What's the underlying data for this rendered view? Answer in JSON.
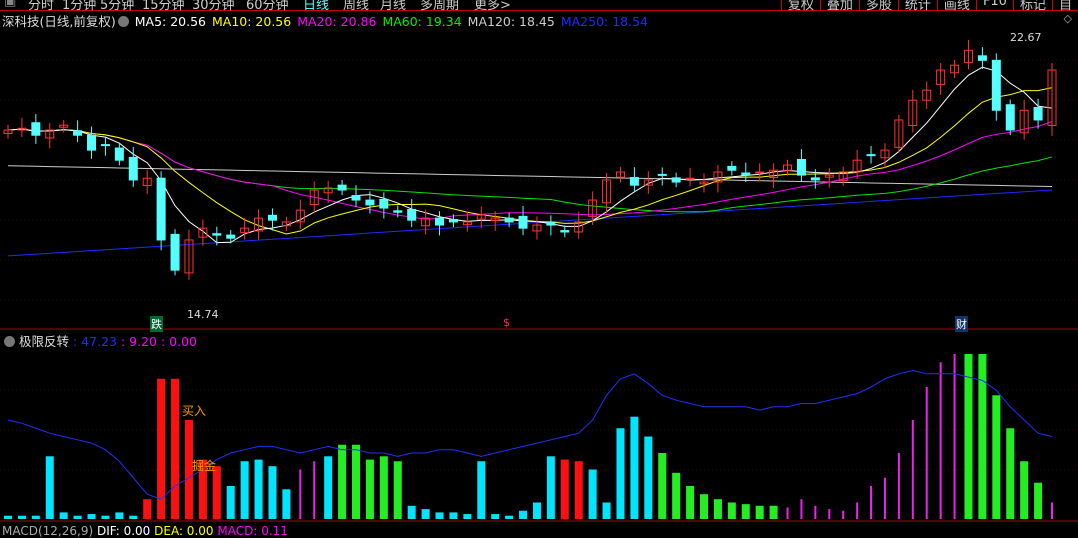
{
  "period_tabs": [
    "分时",
    "1分钟",
    "5分钟",
    "15分钟",
    "30分钟",
    "60分钟",
    "日线",
    "周线",
    "月线",
    "多周期",
    "更多>"
  ],
  "active_tab": "日线",
  "right_tabs": [
    "复权",
    "叠加",
    "多股",
    "统计",
    "画线",
    "F10",
    "标记",
    "自"
  ],
  "legend": {
    "title": "深科技(日线,前复权)",
    "ma5": "MA5: 20.56",
    "ma10": "MA10: 20.56",
    "ma20": "MA20: 20.86",
    "ma60": "MA60: 19.34",
    "ma120": "MA120: 18.45",
    "ma250": "MA250: 18.54"
  },
  "colors": {
    "up": "#ff3232",
    "down": "#54ffff",
    "ma5": "#ffffff",
    "ma10": "#ffff00",
    "ma20": "#ff00ff",
    "ma60": "#00e600",
    "ma120": "#cccccc",
    "ma250": "#1e2aff"
  },
  "price_labels": {
    "high": "22.67",
    "low": "14.74"
  },
  "markers": {
    "die": "跌",
    "dollar": "$",
    "cai": "财"
  },
  "indicator": {
    "name": "极限反转",
    "v1": ": 47.23",
    "v2": ": 9.20",
    "v3": ": 0.00",
    "buy": "买入",
    "gold": "掘金"
  },
  "macd": {
    "name": "MACD(12,26,9)",
    "dif": "DIF: 0.00",
    "dea": "DEA: 0.00",
    "macd": "MACD: 0.11"
  },
  "chart_data": {
    "type": "candlestick",
    "closes": [
      19.93,
      19.98,
      19.78,
      19.93,
      20.07,
      19.78,
      19.35,
      19.49,
      19.06,
      18.49,
      18.54,
      16.76,
      15.89,
      16.76,
      17.1,
      16.9,
      16.81,
      17.1,
      17.39,
      17.33,
      17.28,
      17.62,
      18.2,
      18.26,
      18.2,
      17.91,
      17.77,
      17.68,
      17.56,
      17.33,
      17.39,
      17.19,
      17.28,
      17.28,
      17.48,
      17.39,
      17.28,
      17.1,
      17.19,
      17.19,
      16.99,
      17.28,
      17.91,
      18.49,
      18.72,
      18.34,
      18.49,
      18.63,
      18.43,
      18.54,
      18.43,
      18.72,
      18.77,
      18.63,
      18.72,
      18.77,
      18.92,
      18.63,
      18.49,
      18.63,
      18.72,
      19.06,
      19.21,
      19.35,
      20.22,
      20.79,
      21.08,
      21.66,
      21.8,
      22.23,
      21.94,
      20.5,
      19.93,
      20.5,
      20.22,
      21.66
    ],
    "ma120_range": [
      18.9,
      18.3
    ],
    "ma250_range": [
      16.3,
      18.2
    ],
    "y_range": [
      14.74,
      22.67
    ],
    "indicator_types": "ccccccccccrrrrrrcccccmmcgggggcccccccccccrrcccccgggggggggmmmmmmmmmmmmmggggggmm",
    "indicator_values": [
      2,
      2,
      2,
      38,
      4,
      2,
      3,
      2,
      4,
      2,
      12,
      85,
      85,
      60,
      36,
      32,
      20,
      35,
      36,
      32,
      18,
      30,
      35,
      38,
      45,
      45,
      36,
      38,
      35,
      8,
      6,
      4,
      4,
      3,
      35,
      3,
      2,
      5,
      10,
      38,
      36,
      35,
      30,
      10,
      55,
      62,
      50,
      40,
      28,
      20,
      15,
      12,
      10,
      9,
      8,
      8,
      7,
      12,
      8,
      6,
      5,
      10,
      20,
      25,
      40,
      60,
      80,
      95,
      100,
      100,
      100,
      75,
      55,
      35,
      22,
      10,
      8
    ],
    "blue_line": [
      60,
      58,
      55,
      52,
      50,
      48,
      46,
      42,
      35,
      25,
      15,
      12,
      20,
      25,
      30,
      36,
      40,
      42,
      44,
      44,
      42,
      40,
      42,
      44,
      42,
      42,
      40,
      40,
      38,
      40,
      40,
      42,
      42,
      40,
      38,
      40,
      42,
      44,
      46,
      48,
      50,
      52,
      60,
      75,
      85,
      88,
      82,
      75,
      72,
      70,
      68,
      68,
      68,
      68,
      66,
      68,
      68,
      70,
      70,
      72,
      74,
      76,
      80,
      85,
      88,
      90,
      88,
      88,
      88,
      86,
      84,
      78,
      68,
      60,
      52,
      50
    ]
  }
}
